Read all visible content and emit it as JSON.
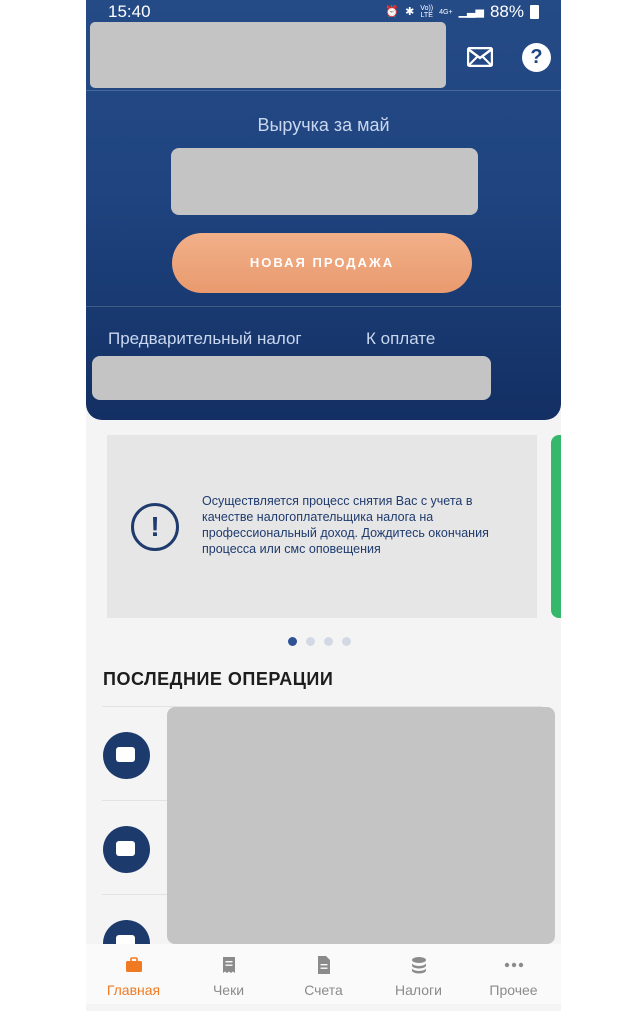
{
  "status": {
    "time": "15:40",
    "volte": "Vo))",
    "lte": "LTE",
    "net": "4G+",
    "battery": "88%"
  },
  "header": {
    "revenue_label": "Выручка за май",
    "new_sale_button": "НОВАЯ ПРОДАЖА",
    "prelim_tax_label": "Предварительный налог",
    "to_pay_label": "К оплате"
  },
  "banner": {
    "message": "Осуществляется процесс снятия Вас с учета в качестве налогоплательщика налога на профессиональный доход. Дождитесь окончания процесса или смс оповещения",
    "pages": 4,
    "active_page": 1
  },
  "operations": {
    "title": "ПОСЛЕДНИЕ ОПЕРАЦИИ"
  },
  "nav": [
    {
      "label": "Главная",
      "icon": "briefcase-icon",
      "active": true
    },
    {
      "label": "Чеки",
      "icon": "receipt-icon",
      "active": false
    },
    {
      "label": "Счета",
      "icon": "document-icon",
      "active": false
    },
    {
      "label": "Налоги",
      "icon": "coins-icon",
      "active": false
    },
    {
      "label": "Прочее",
      "icon": "more-dots-icon",
      "active": false
    }
  ],
  "colors": {
    "accent": "#f07a22",
    "header_blue": "#1f4480",
    "sale_button": "#e99a6e",
    "banner_next": "#35b86a"
  }
}
